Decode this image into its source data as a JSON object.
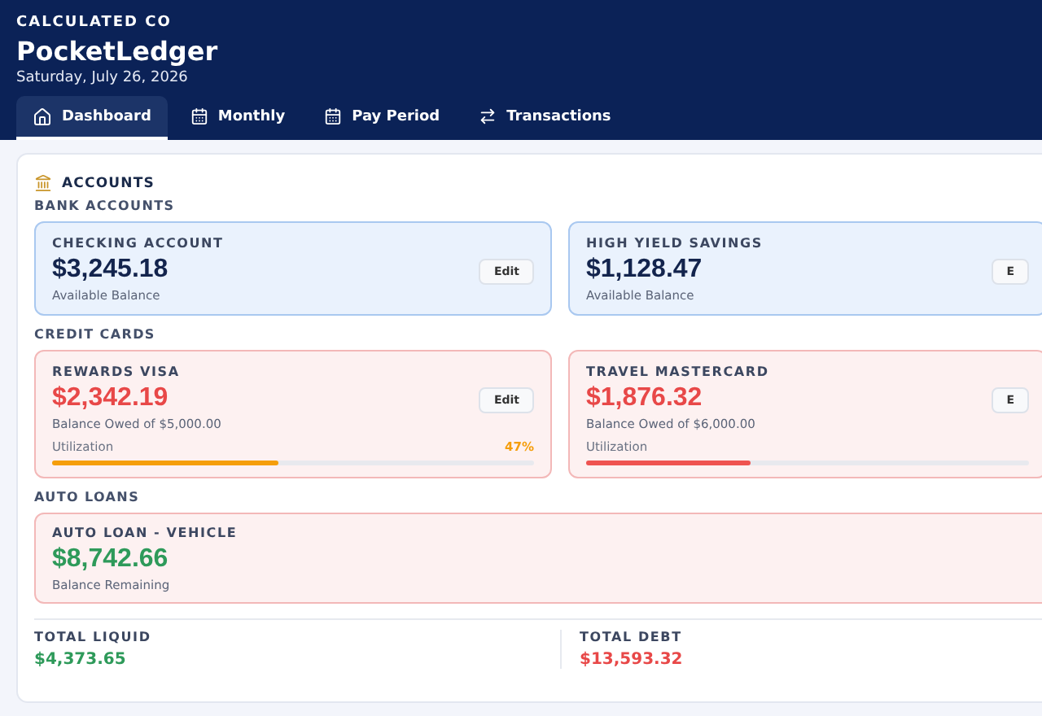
{
  "header": {
    "company": "CALCULATED CO",
    "app_name": "PocketLedger",
    "date": "Saturday, July 26, 2026"
  },
  "tabs": [
    {
      "label": "Dashboard",
      "selected": true
    },
    {
      "label": "Monthly",
      "selected": false
    },
    {
      "label": "Pay Period",
      "selected": false
    },
    {
      "label": "Transactions",
      "selected": false
    }
  ],
  "accounts": {
    "title": "ACCOUNTS",
    "groups": [
      {
        "title": "BANK ACCOUNTS",
        "cards": [
          {
            "kind": "bank",
            "name": "CHECKING ACCOUNT",
            "amount": "$3,245.18",
            "caption": "Available Balance",
            "edit": "Edit"
          },
          {
            "kind": "bank",
            "name": "HIGH YIELD SAVINGS",
            "amount": "$1,128.47",
            "caption": "Available Balance",
            "edit": "E"
          }
        ]
      },
      {
        "title": "CREDIT CARDS",
        "cards": [
          {
            "kind": "credit",
            "name": "REWARDS VISA",
            "amount": "$2,342.19",
            "caption": "Balance Owed of $5,000.00",
            "edit": "Edit",
            "utilization_label": "Utilization",
            "utilization": "47%",
            "level": 0.47,
            "color": "#f59e0b"
          },
          {
            "kind": "credit",
            "name": "TRAVEL MASTERCARD",
            "amount": "$1,876.32",
            "caption": "Balance Owed of $6,000.00",
            "edit": "E",
            "utilization_label": "Utilization",
            "level": 0.37,
            "color": "#ef5350"
          }
        ]
      },
      {
        "title": "AUTO LOANS",
        "cards": [
          {
            "kind": "loan",
            "name": "AUTO LOAN - VEHICLE",
            "amount": "$8,742.66",
            "caption": "Balance Remaining"
          }
        ]
      }
    ]
  },
  "totals": [
    {
      "label": "TOTAL LIQUID",
      "value": "$4,373.65",
      "kind": "positive"
    },
    {
      "label": "TOTAL DEBT",
      "value": "$13,593.32",
      "kind": "negative"
    }
  ]
}
